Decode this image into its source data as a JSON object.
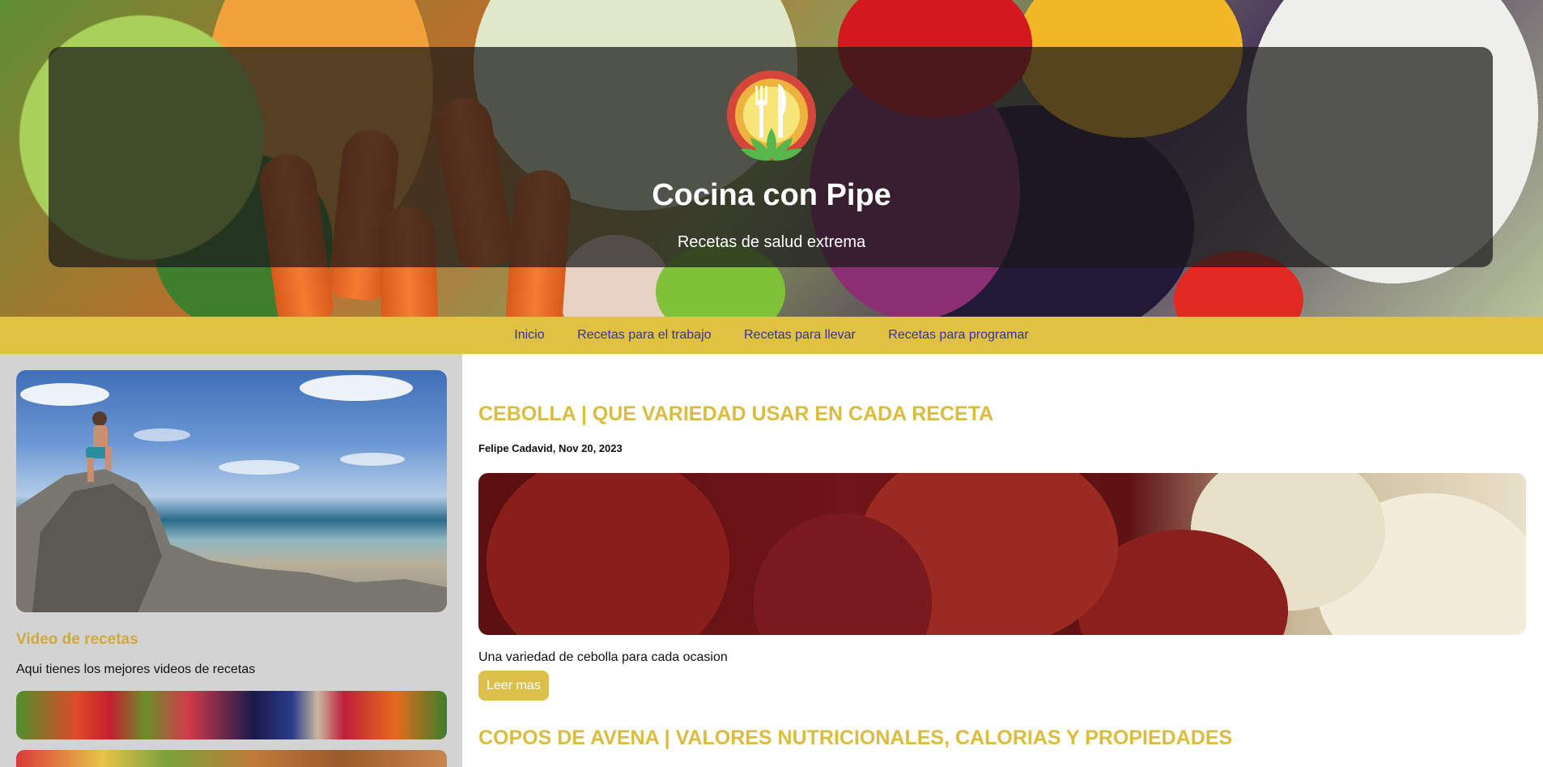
{
  "header": {
    "title": "Cocina con Pipe",
    "subtitle": "Recetas de salud extrema",
    "logo_icon": "fork-knife-lotus-logo"
  },
  "nav": {
    "items": [
      {
        "label": "Inicio"
      },
      {
        "label": "Recetas para el trabajo"
      },
      {
        "label": "Recetas para llevar"
      },
      {
        "label": "Recetas para programar"
      }
    ]
  },
  "sidebar": {
    "title": "Video de recetas",
    "text": "Aqui tienes los mejores videos de recetas"
  },
  "posts": [
    {
      "title": "CEBOLLA | QUE VARIEDAD USAR EN CADA RECETA",
      "meta": "Felipe Cadavid, Nov 20, 2023",
      "excerpt": "Una variedad de cebolla para cada ocasion",
      "read_more": "Leer mas"
    },
    {
      "title": "COPOS DE AVENA | VALORES NUTRICIONALES, CALORIAS Y PROPIEDADES"
    }
  ],
  "colors": {
    "accent_yellow": "#dfc242",
    "title_gold": "#dcbc3e",
    "nav_link": "#3a2cae",
    "sidebar_bg": "#d3d3d3"
  }
}
